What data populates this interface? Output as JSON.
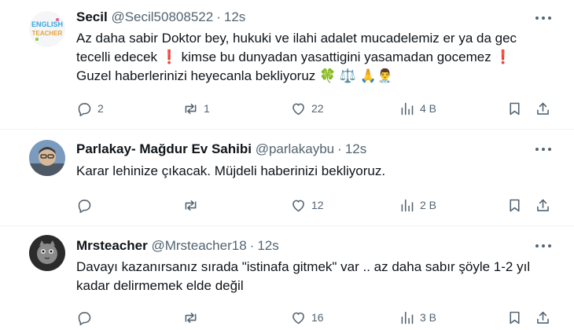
{
  "tweets": [
    {
      "name": "Secil",
      "handle": "@Secil50808522",
      "time": "12s",
      "avatar_text": "ENGLISH TEACHER",
      "lines": [
        "Az daha sabir Doktor bey, hukuki ve ilahi adalet mucadelemiz er ya da gec",
        "tecelli edecek ❗ kimse bu dunyadan yasattigini yasamadan gocemez ❗",
        "Guzel haberlerinizi heyecanla bekliyoruz 🍀 ⚖️ 🙏👨‍⚕️"
      ],
      "replies": "2",
      "reposts": "1",
      "likes": "22",
      "views": "4 B"
    },
    {
      "name": "Parlakay- Mağdur Ev Sahibi",
      "handle": "@parlakaybu",
      "time": "12s",
      "lines": [
        "Karar lehinize çıkacak.  Müjdeli haberinizi bekliyoruz."
      ],
      "replies": "",
      "reposts": "",
      "likes": "12",
      "views": "2 B"
    },
    {
      "name": "Mrsteacher",
      "handle": "@Mrsteacher18",
      "time": "12s",
      "lines": [
        "Davayı kazanırsanız sırada \"istinafa gitmek\" var .. az daha sabır şöyle 1-2 yıl",
        "kadar delirmemek elde değil"
      ],
      "replies": "",
      "reposts": "",
      "likes": "16",
      "views": "3 B"
    }
  ],
  "colors": {
    "text": "#0f1419",
    "secondary": "#536471",
    "divider": "#eff3f4",
    "exclaim": "#e0245e"
  },
  "icons": [
    "more-icon",
    "reply-icon",
    "repost-icon",
    "like-icon",
    "views-icon",
    "bookmark-icon",
    "share-icon"
  ]
}
